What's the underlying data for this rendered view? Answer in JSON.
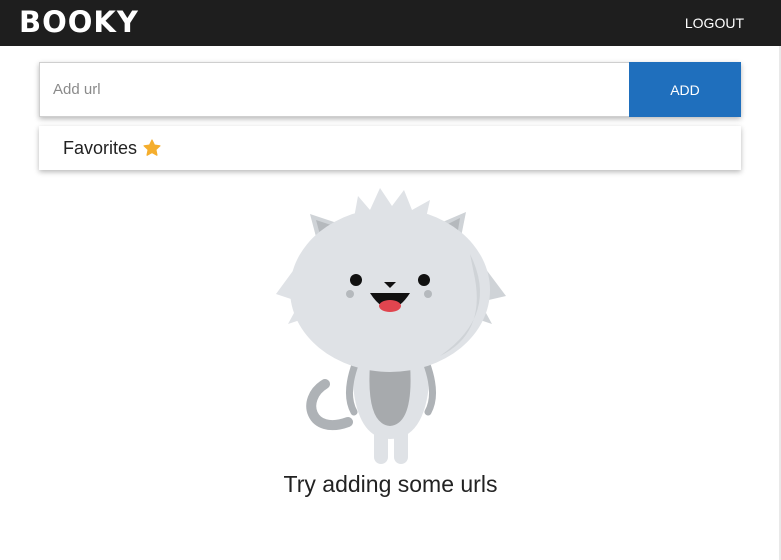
{
  "header": {
    "brand": "BOOKY",
    "logout_label": "LOGOUT"
  },
  "add_bar": {
    "placeholder": "Add url",
    "value": "",
    "add_label": "ADD"
  },
  "favorites": {
    "label": "Favorites",
    "icon": "star-icon"
  },
  "empty_state": {
    "message": "Try adding some urls",
    "illustration": "cat-mascot"
  },
  "colors": {
    "header_bg": "#1e1e1e",
    "accent": "#1f6fbd",
    "star": "#f5ae2d"
  }
}
